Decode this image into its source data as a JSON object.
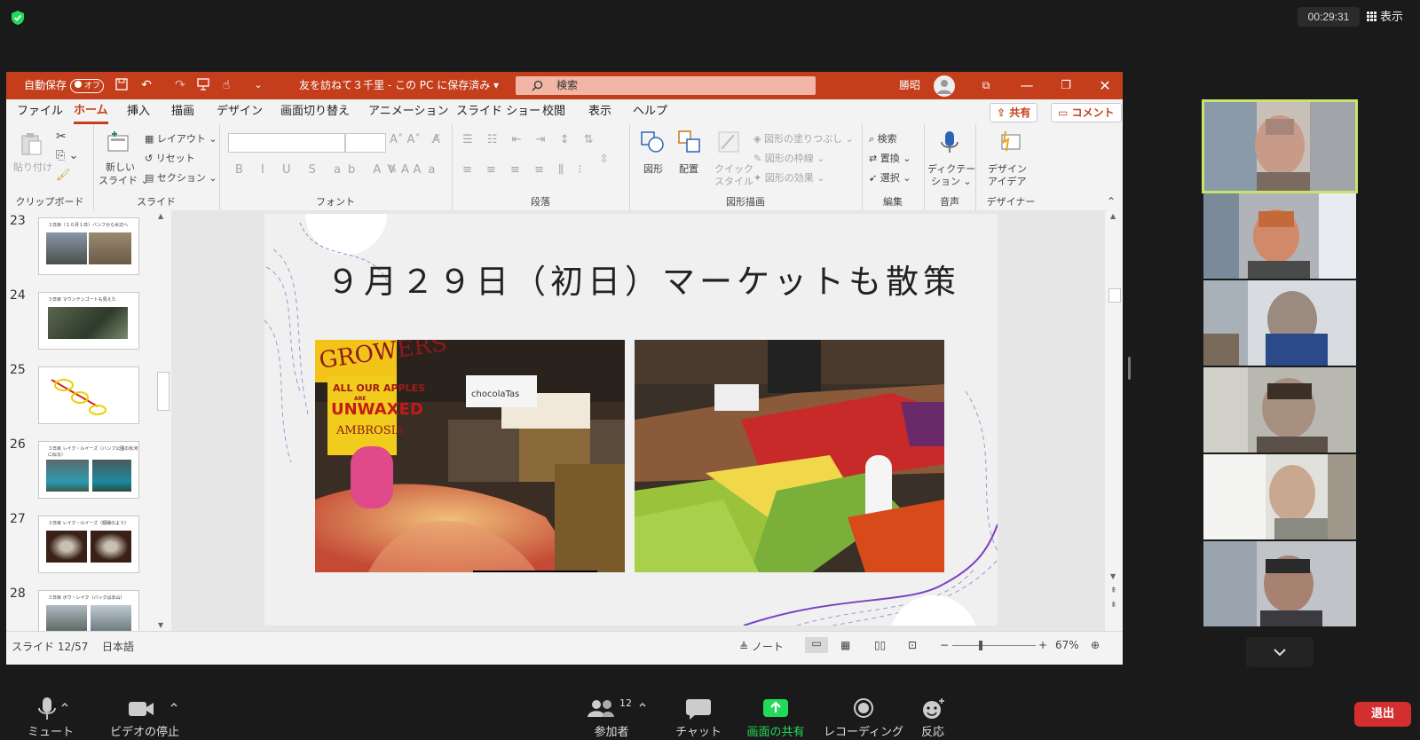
{
  "zoom": {
    "timer": "00:29:31",
    "view_label": "表示",
    "toolbar": {
      "mute": "ミュート",
      "stop_video": "ビデオの停止",
      "participants": "参加者",
      "participant_count": "12",
      "chat": "チャット",
      "share_screen": "画面の共有",
      "recording": "レコーディング",
      "reactions": "反応",
      "leave": "退出"
    },
    "colors": {
      "share_green": "#23d959",
      "leave_red": "#d32f2f",
      "active_speaker": "#c9e36b"
    }
  },
  "ppt": {
    "autosave": "自動保存",
    "autosave_state": "オフ",
    "doc_title": "友を訪ねて３千里 - この PC に保存済み",
    "search_placeholder": "検索",
    "user": "勝昭",
    "menu": [
      "ファイル",
      "ホーム",
      "挿入",
      "描画",
      "デザイン",
      "画面切り替え",
      "アニメーション",
      "スライド ショー",
      "校閲",
      "表示",
      "ヘルプ"
    ],
    "share": "共有",
    "comment": "コメント",
    "ribbon": {
      "clipboard": {
        "label": "クリップボード",
        "paste": "貼り付け"
      },
      "slides": {
        "label": "スライド",
        "new_slide_1": "新しい",
        "new_slide_2": "スライド",
        "layout": "レイアウト",
        "reset": "リセット",
        "section": "セクション"
      },
      "font": {
        "label": "フォント"
      },
      "paragraph": {
        "label": "段落"
      },
      "drawing": {
        "label": "図形描画",
        "shapes": "図形",
        "arrange": "配置",
        "quick_1": "クイック",
        "quick_2": "スタイル",
        "fill": "図形の塗りつぶし",
        "outline": "図形の枠線",
        "effects": "図形の効果"
      },
      "editing": {
        "label": "編集",
        "find": "検索",
        "replace": "置換",
        "select": "選択"
      },
      "voice": {
        "label": "音声",
        "dictate_1": "ディクテー",
        "dictate_2": "ション"
      },
      "designer": {
        "label": "デザイナー",
        "ideas_1": "デザイン",
        "ideas_2": "アイデア"
      }
    },
    "thumbnails": [
      {
        "num": "23",
        "caption": "３日目（１０月１日）バンフから水辺へ"
      },
      {
        "num": "24",
        "caption": "３日目 マウンテンゴートも見えた"
      },
      {
        "num": "25",
        "caption": ""
      },
      {
        "num": "26",
        "caption": "３日目 レイク・ルイーズ（バンフ公園の氷河に似る）"
      },
      {
        "num": "27",
        "caption": "３日目 レイク・ルイーズ（額縁のよう）"
      },
      {
        "num": "28",
        "caption": "３日目 ボウ・レイク（バックは氷山）"
      }
    ],
    "slide_title": "９月２９日（初日）マーケットも散策",
    "photo_sign": {
      "line1": "GROWERS",
      "line2": "ALL OUR APPLES",
      "line3": "ARE",
      "line4": "UNWAXED",
      "line5": "AMBROSIA",
      "shop": "chocolaTas"
    },
    "status": {
      "slide_pos": "スライド 12/57",
      "lang": "日本語",
      "notes": "ノート",
      "zoom": "67%"
    },
    "accent": "#c43e1c"
  }
}
